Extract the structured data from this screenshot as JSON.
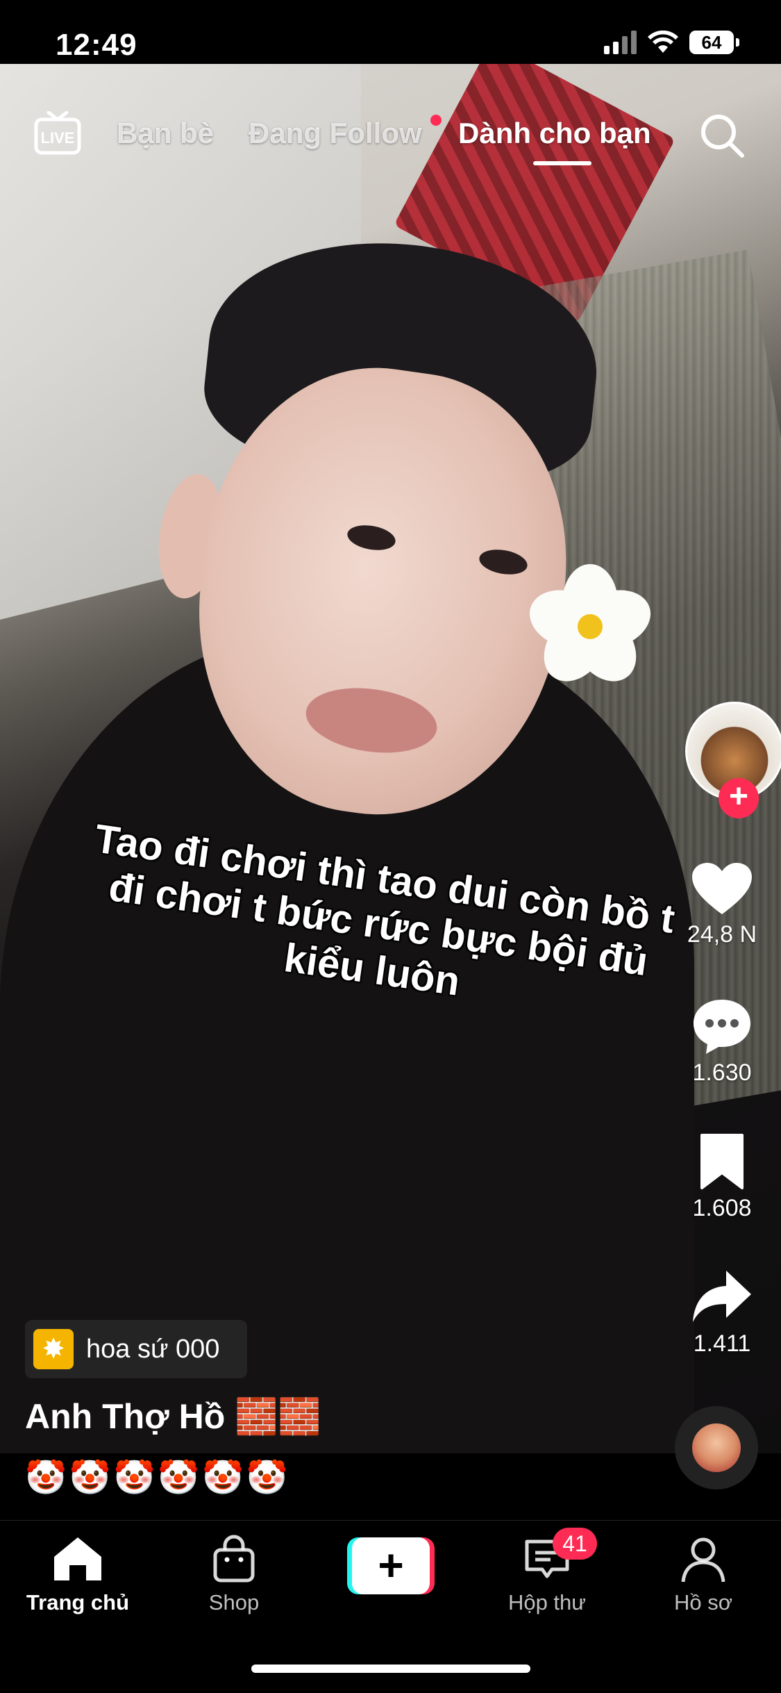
{
  "status_bar": {
    "time": "12:49",
    "battery": "64"
  },
  "top_nav": {
    "live_label": "LIVE",
    "tabs": [
      {
        "label": "Bạn bè"
      },
      {
        "label": "Đang Follow"
      },
      {
        "label": "Dành cho bạn"
      }
    ],
    "active_tab": "Dành cho bạn"
  },
  "video": {
    "caption": "Tao đi chơi thì tao dui còn bồ t đi chơi t bức rức bực bội đủ kiểu luôn"
  },
  "sidebar": {
    "likes": "24,8 N",
    "comments": "1.630",
    "saves": "1.608",
    "shares": "1.411"
  },
  "effect": {
    "label": "hoa sứ 000",
    "icon": "sparkle-icon"
  },
  "post": {
    "author": "Anh Thợ Hồ 🧱🧱",
    "description": "🤡🤡🤡🤡🤡🤡"
  },
  "bottom_nav": {
    "items": [
      {
        "label": "Trang chủ"
      },
      {
        "label": "Shop"
      },
      {
        "label": "Hộp thư",
        "badge": "41"
      },
      {
        "label": "Hồ sơ"
      }
    ]
  },
  "colors": {
    "accent": "#fe2c55",
    "cyan": "#25f4ee"
  }
}
